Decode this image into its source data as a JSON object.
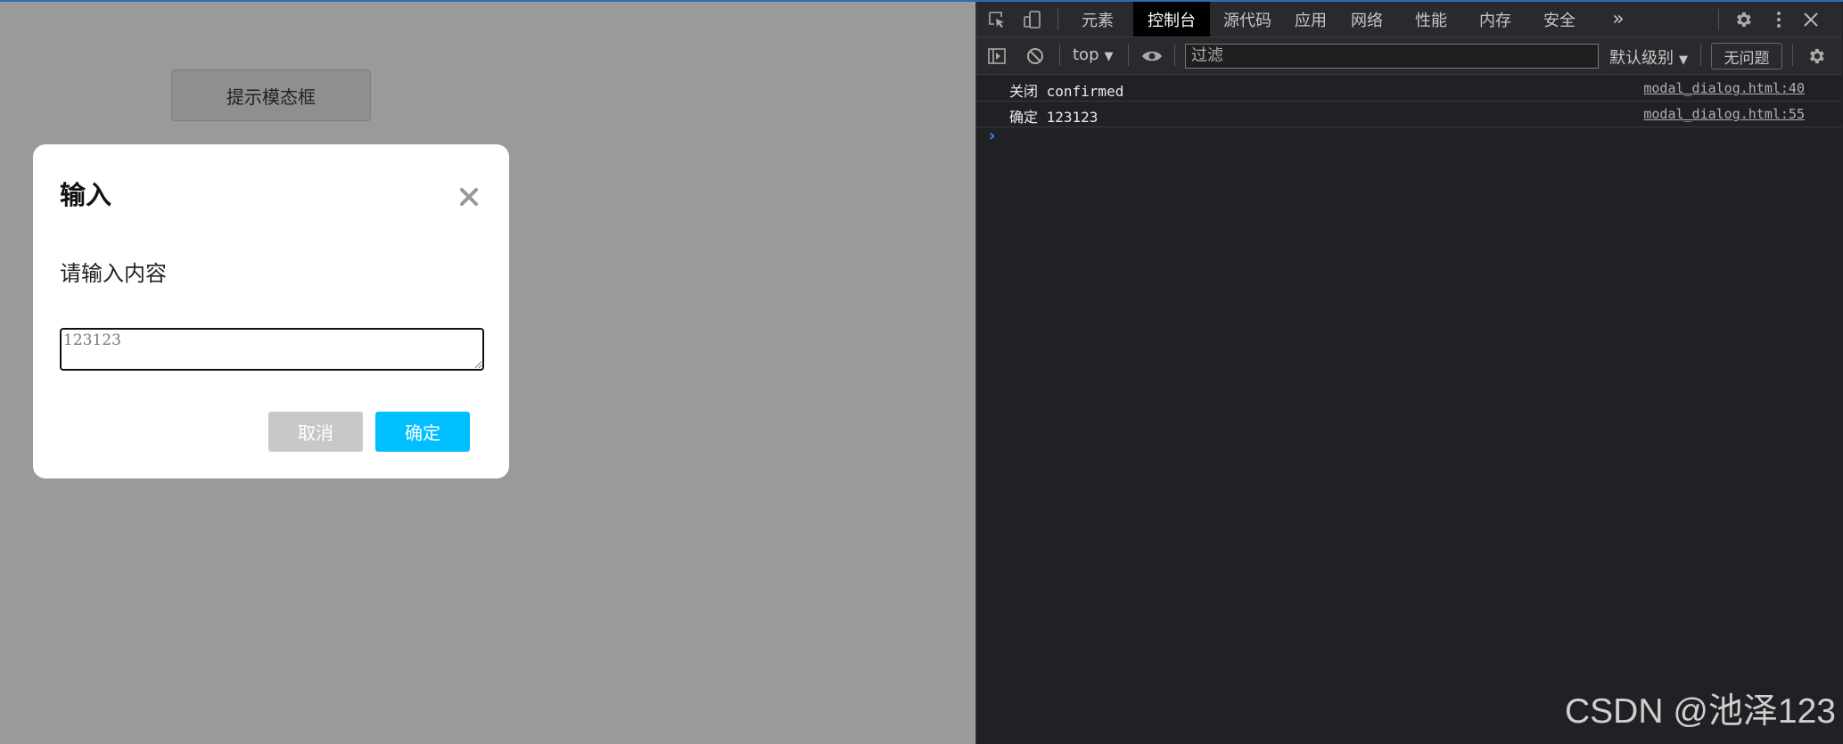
{
  "page": {
    "trigger_button": "提示模态框"
  },
  "modal": {
    "title": "输入",
    "message": "请输入内容",
    "input_value": "123123",
    "cancel_label": "取消",
    "confirm_label": "确定",
    "accent_color": "#00bfff"
  },
  "devtools": {
    "tabs": [
      {
        "label": "元素",
        "active": false
      },
      {
        "label": "控制台",
        "active": true
      },
      {
        "label": "源代码",
        "active": false
      },
      {
        "label": "应用",
        "active": false
      },
      {
        "label": "网络",
        "active": false
      },
      {
        "label": "性能",
        "active": false
      },
      {
        "label": "内存",
        "active": false
      },
      {
        "label": "安全",
        "active": false
      }
    ],
    "more_tabs": "»",
    "context": "top",
    "filter_placeholder": "过滤",
    "level": "默认级别",
    "issues": "无问题",
    "logs": [
      {
        "text": "关闭 confirmed",
        "source": "modal_dialog.html:40"
      },
      {
        "text": "确定 123123",
        "source": "modal_dialog.html:55"
      }
    ],
    "prompt_symbol": "›"
  },
  "watermark": "CSDN @池泽123"
}
